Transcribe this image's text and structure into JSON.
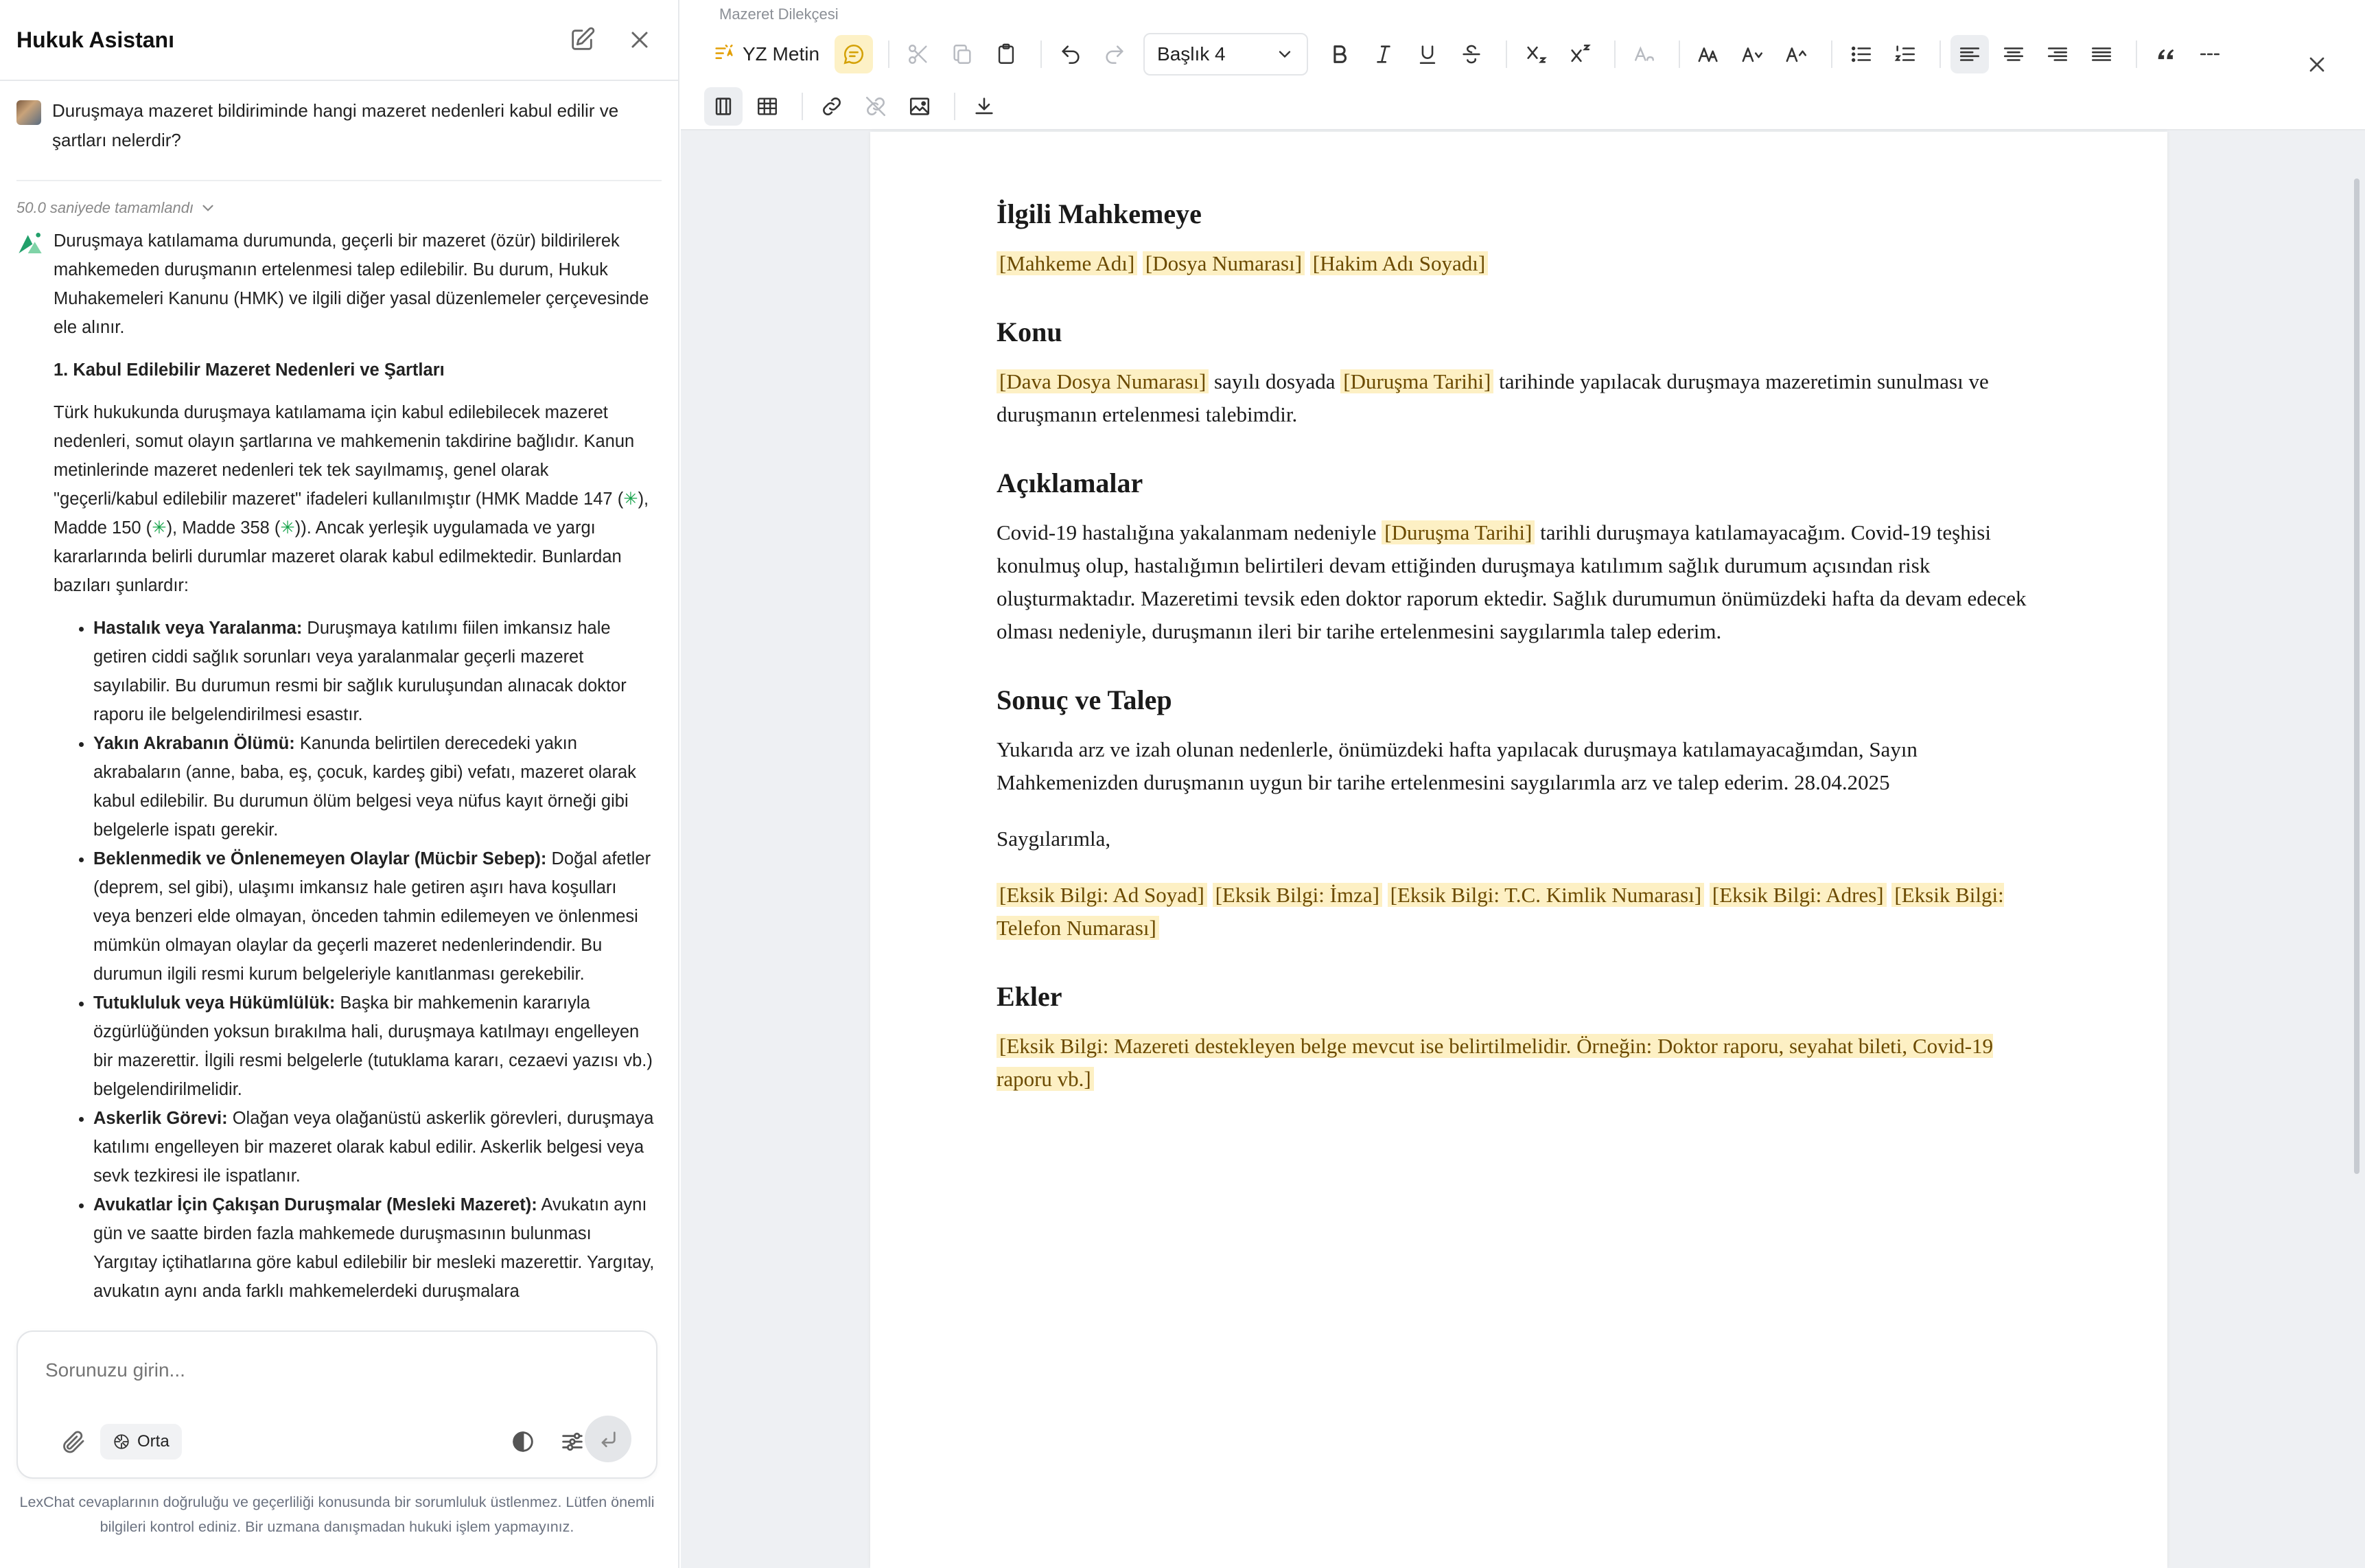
{
  "chat": {
    "title": "Hukuk Asistanı",
    "user_message": "Duruşmaya mazeret bildiriminde hangi mazeret nedenleri kabul edilir ve şartları nelerdir?",
    "thinking_status": "50.0 saniyede tamamlandı",
    "answer": {
      "intro": "Duruşmaya katılamama durumunda, geçerli bir mazeret (özür) bildirilerek mahkemeden duruşmanın ertelenmesi talep edilebilir. Bu durum, Hukuk Muhakemeleri Kanunu (HMK) ve ilgili diğer yasal düzenlemeler çerçevesinde ele alınır.",
      "heading1": "1. Kabul Edilebilir Mazeret Nedenleri ve Şartları",
      "para1_a": "Türk hukukunda duruşmaya katılamama için kabul edilebilecek mazeret nedenleri, somut olayın şartlarına ve mahkemenin takdirine bağlıdır. Kanun metinlerinde mazeret nedenleri tek tek sayılmamış, genel olarak \"geçerli/kabul edilebilir mazeret\" ifadeleri kullanılmıştır (HMK Madde 147 (",
      "ref_glyph": "✳",
      "para1_b": "), Madde 150 (",
      "para1_c": "), Madde 358 (",
      "para1_d": ")). Ancak yerleşik uygulamada ve yargı kararlarında belirli durumlar mazeret olarak kabul edilmektedir. Bunlardan bazıları şunlardır:",
      "items": [
        {
          "title": "Hastalık veya Yaralanma:",
          "text": " Duruşmaya katılımı fiilen imkansız hale getiren ciddi sağlık sorunları veya yaralanmalar geçerli mazeret sayılabilir. Bu durumun resmi bir sağlık kuruluşundan alınacak doktor raporu ile belgelendirilmesi esastır."
        },
        {
          "title": "Yakın Akrabanın Ölümü:",
          "text": " Kanunda belirtilen derecedeki yakın akrabaların (anne, baba, eş, çocuk, kardeş gibi) vefatı, mazeret olarak kabul edilebilir. Bu durumun ölüm belgesi veya nüfus kayıt örneği gibi belgelerle ispatı gerekir."
        },
        {
          "title": "Beklenmedik ve Önlenemeyen Olaylar (Mücbir Sebep):",
          "text": " Doğal afetler (deprem, sel gibi), ulaşımı imkansız hale getiren aşırı hava koşulları veya benzeri elde olmayan, önceden tahmin edilemeyen ve önlenmesi mümkün olmayan olaylar da geçerli mazeret nedenlerindendir. Bu durumun ilgili resmi kurum belgeleriyle kanıtlanması gerekebilir."
        },
        {
          "title": "Tutukluluk veya Hükümlülük:",
          "text": " Başka bir mahkemenin kararıyla özgürlüğünden yoksun bırakılma hali, duruşmaya katılmayı engelleyen bir mazerettir. İlgili resmi belgelerle (tutuklama kararı, cezaevi yazısı vb.) belgelendirilmelidir."
        },
        {
          "title": "Askerlik Görevi:",
          "text": " Olağan veya olağanüstü askerlik görevleri, duruşmaya katılımı engelleyen bir mazeret olarak kabul edilir. Askerlik belgesi veya sevk tezkiresi ile ispatlanır."
        },
        {
          "title": "Avukatlar İçin Çakışan Duruşmalar (Mesleki Mazeret):",
          "text": " Avukatın aynı gün ve saatte birden fazla mahkemede duruşmasının bulunması Yargıtay içtihatlarına göre kabul edilebilir bir mesleki mazerettir. Yargıtay, avukatın aynı anda farklı mahkemelerdeki duruşmalara"
        }
      ]
    },
    "composer": {
      "placeholder": "Sorunuzu girin...",
      "mode": "Orta"
    },
    "disclaimer": "LexChat cevaplarının doğruluğu ve geçerliliği konusunda bir sorumluluk üstlenmez. Lütfen önemli bilgileri kontrol ediniz. Bir uzmana danışmadan hukuki işlem yapmayınız."
  },
  "editor": {
    "doc_name": "Mazeret Dilekçesi",
    "ai_text_label": "YZ Metin",
    "heading_select": "Başlık 4",
    "document": {
      "s1_title": "İlgili Mahkemeye",
      "s1_ph1": "[Mahkeme Adı]",
      "s1_ph2": "[Dosya Numarası]",
      "s1_ph3": "[Hakim Adı Soyadı]",
      "s2_title": "Konu",
      "s2_ph1": "[Dava Dosya Numarası]",
      "s2_t1": " sayılı dosyada ",
      "s2_ph2": "[Duruşma Tarihi]",
      "s2_t2": " tarihinde yapılacak duruşmaya mazeretimin sunulması ve duruşmanın ertelenmesi talebimdir.",
      "s3_title": "Açıklamalar",
      "s3_t1": "Covid-19 hastalığına yakalanmam nedeniyle ",
      "s3_ph1": "[Duruşma Tarihi]",
      "s3_t2": " tarihli duruşmaya katılamayacağım. Covid-19 teşhisi konulmuş olup, hastalığımın belirtileri devam ettiğinden duruşmaya katılımım sağlık durumum açısından risk oluşturmaktadır. Mazeretimi tevsik eden doktor raporum ektedir. Sağlık durumumun önümüzdeki hafta da devam edecek olması nedeniyle, duruşmanın ileri bir tarihe ertelenmesini saygılarımla talep ederim.",
      "s4_title": "Sonuç ve Talep",
      "s4_t1": "Yukarıda arz ve izah olunan nedenlerle, önümüzdeki hafta yapılacak duruşmaya katılamayacağımdan, Sayın Mahkemenizden duruşmanın uygun bir tarihe ertelenmesini saygılarımla arz ve talep ederim. 28.04.2025",
      "s4_t2": "Saygılarımla,",
      "s4_ph1": "[Eksik Bilgi: Ad Soyad]",
      "s4_ph2": "[Eksik Bilgi: İmza]",
      "s4_ph3": "[Eksik Bilgi: T.C. Kimlik Numarası]",
      "s4_ph4": "[Eksik Bilgi: Adres]",
      "s4_ph5": "[Eksik Bilgi: Telefon Numarası]",
      "s5_title": "Ekler",
      "s5_ph1": "[Eksik Bilgi: Mazereti destekleyen belge mevcut ise belirtilmelidir. Örneğin: Doktor raporu, seyahat bileti, Covid-19 raporu vb.]"
    }
  },
  "colors": {
    "placeholder_bg": "#fdf0c4",
    "ref_green": "#16a34a",
    "ai_accent": "#e3a008"
  }
}
